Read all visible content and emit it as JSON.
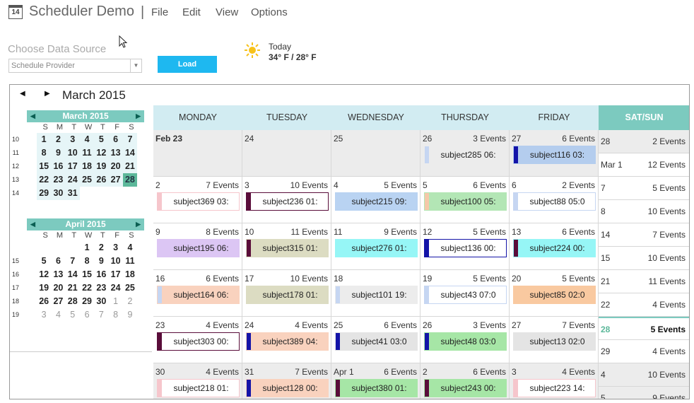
{
  "app": {
    "icon_text": "14",
    "title": "Scheduler Demo",
    "separator": "|"
  },
  "menu": [
    "File",
    "Edit",
    "View",
    "Options"
  ],
  "data_source": {
    "label": "Choose Data Source",
    "selected": "Schedule Provider",
    "load_label": "Load"
  },
  "weather": {
    "today": "Today",
    "temp": "34° F / 28° F",
    "icon": "sun-icon"
  },
  "scheduler": {
    "title": "March 2015",
    "prev": "◀",
    "next": "▶"
  },
  "mini_calendars": [
    {
      "title": "March 2015",
      "dow": [
        "S",
        "M",
        "T",
        "W",
        "T",
        "F",
        "S"
      ],
      "weeks": [
        {
          "wk": "10",
          "days": [
            "1",
            "2",
            "3",
            "4",
            "5",
            "6",
            "7"
          ]
        },
        {
          "wk": "11",
          "days": [
            "8",
            "9",
            "10",
            "11",
            "12",
            "13",
            "14"
          ]
        },
        {
          "wk": "12",
          "days": [
            "15",
            "16",
            "17",
            "18",
            "19",
            "20",
            "21"
          ]
        },
        {
          "wk": "13",
          "days": [
            "22",
            "23",
            "24",
            "25",
            "26",
            "27",
            "28"
          ]
        },
        {
          "wk": "14",
          "days": [
            "29",
            "30",
            "31",
            "",
            "",
            "",
            ""
          ]
        }
      ]
    },
    {
      "title": "April 2015",
      "dow": [
        "S",
        "M",
        "T",
        "W",
        "T",
        "F",
        "S"
      ],
      "weeks": [
        {
          "wk": "",
          "days": [
            "",
            "",
            "",
            "1",
            "2",
            "3",
            "4"
          ]
        },
        {
          "wk": "15",
          "days": [
            "5",
            "6",
            "7",
            "8",
            "9",
            "10",
            "11"
          ]
        },
        {
          "wk": "16",
          "days": [
            "12",
            "13",
            "14",
            "15",
            "16",
            "17",
            "18"
          ]
        },
        {
          "wk": "17",
          "days": [
            "19",
            "20",
            "21",
            "22",
            "23",
            "24",
            "25"
          ]
        },
        {
          "wk": "18",
          "days": [
            "26",
            "27",
            "28",
            "29",
            "30",
            "1",
            "2"
          ]
        },
        {
          "wk": "19",
          "days": [
            "3",
            "4",
            "5",
            "6",
            "7",
            "8",
            "9"
          ]
        }
      ]
    }
  ],
  "day_headers": [
    "MONDAY",
    "TUESDAY",
    "WEDNESDAY",
    "THURSDAY",
    "FRIDAY",
    "SAT/SUN"
  ],
  "weeks": [
    {
      "days": [
        {
          "date": "Feb 23",
          "count": "",
          "event": "",
          "color": "",
          "bar": ""
        },
        {
          "date": "24",
          "count": "",
          "event": "",
          "color": "",
          "bar": ""
        },
        {
          "date": "25",
          "count": "",
          "event": "",
          "color": "",
          "bar": ""
        },
        {
          "date": "26",
          "count": "3 Events",
          "event": "subject285 06:",
          "color": "#ececec",
          "bar": "#c6d6f2"
        },
        {
          "date": "27",
          "count": "6 Events",
          "event": "subject116 03:",
          "color": "#b4cdee",
          "bar": "#1414a8"
        }
      ],
      "weekend": [
        {
          "date": "28",
          "count": "2 Events"
        },
        {
          "date": "Mar 1",
          "count": "12 Events"
        }
      ]
    },
    {
      "days": [
        {
          "date": "2",
          "count": "7 Events",
          "event": "subject369 03:",
          "color": "#ffffff",
          "bar": "#f6c6cc"
        },
        {
          "date": "3",
          "count": "10 Events",
          "event": "subject236 01:",
          "color": "#ffffff",
          "bar": "#5a0d3a"
        },
        {
          "date": "4",
          "count": "5 Events",
          "event": "subject215 09:",
          "color": "#b9d3f2",
          "bar": "#b9d3f2"
        },
        {
          "date": "5",
          "count": "6 Events",
          "event": "subject100 05:",
          "color": "#b3e6b5",
          "bar": "#f4c8a8"
        },
        {
          "date": "6",
          "count": "2 Events",
          "event": "subject88 05:0",
          "color": "#ffffff",
          "bar": "#c6d6f2"
        }
      ],
      "weekend": [
        {
          "date": "7",
          "count": "5 Events"
        },
        {
          "date": "8",
          "count": "10 Events"
        }
      ]
    },
    {
      "days": [
        {
          "date": "9",
          "count": "8 Events",
          "event": "subject195 06:",
          "color": "#dcc6f4",
          "bar": "#dcc6f4"
        },
        {
          "date": "10",
          "count": "11 Events",
          "event": "subject315 01:",
          "color": "#dcdcc2",
          "bar": "#5a0d3a"
        },
        {
          "date": "11",
          "count": "9 Events",
          "event": "subject276 01:",
          "color": "#96f6f6",
          "bar": "#96f6f6"
        },
        {
          "date": "12",
          "count": "5 Events",
          "event": "subject136 00:",
          "color": "#ffffff",
          "bar": "#1414a8"
        },
        {
          "date": "13",
          "count": "6 Events",
          "event": "subject224 00:",
          "color": "#96f6f6",
          "bar": "#5a0d3a"
        }
      ],
      "weekend": [
        {
          "date": "14",
          "count": "7 Events"
        },
        {
          "date": "15",
          "count": "10 Events"
        }
      ]
    },
    {
      "days": [
        {
          "date": "16",
          "count": "6 Events",
          "event": "subject164 06:",
          "color": "#f9d2be",
          "bar": "#c6d6f2"
        },
        {
          "date": "17",
          "count": "10 Events",
          "event": "subject178 01:",
          "color": "#dcdcc2",
          "bar": "#dcdcc2"
        },
        {
          "date": "18",
          "count": "",
          "event": "subject101 19:",
          "color": "#ececec",
          "bar": "#c6d6f2"
        },
        {
          "date": "19",
          "count": "5 Events",
          "event": "subject43 07:0",
          "color": "#ffffff",
          "bar": "#c6d6f2"
        },
        {
          "date": "20",
          "count": "5 Events",
          "event": "subject85 02:0",
          "color": "#f9c9a0",
          "bar": "#f9c9a0"
        }
      ],
      "weekend": [
        {
          "date": "21",
          "count": "11 Events"
        },
        {
          "date": "22",
          "count": "4 Events"
        }
      ]
    },
    {
      "days": [
        {
          "date": "23",
          "count": "4 Events",
          "event": "subject303 00:",
          "color": "#ffffff",
          "bar": "#5a0d3a"
        },
        {
          "date": "24",
          "count": "4 Events",
          "event": "subject389 04:",
          "color": "#f9d2be",
          "bar": "#1414a8"
        },
        {
          "date": "25",
          "count": "6 Events",
          "event": "subject41 03:0",
          "color": "#e4e4e4",
          "bar": "#1414a8"
        },
        {
          "date": "26",
          "count": "3 Events",
          "event": "subject48 03:0",
          "color": "#a6e6a6",
          "bar": "#1414a8"
        },
        {
          "date": "27",
          "count": "7 Events",
          "event": "subject13 02:0",
          "color": "#e4e4e4",
          "bar": "#e4e4e4"
        }
      ],
      "weekend": [
        {
          "date": "28",
          "count": "5 Events",
          "today": true
        },
        {
          "date": "29",
          "count": "4 Events"
        }
      ]
    },
    {
      "days": [
        {
          "date": "30",
          "count": "4 Events",
          "event": "subject218 01:",
          "color": "#ffffff",
          "bar": "#f6c6cc"
        },
        {
          "date": "31",
          "count": "7 Events",
          "event": "subject128 00:",
          "color": "#f9d2be",
          "bar": "#1414a8"
        },
        {
          "date": "Apr 1",
          "count": "6 Events",
          "event": "subject380 01:",
          "color": "#a6e6a6",
          "bar": "#5a0d3a"
        },
        {
          "date": "2",
          "count": "6 Events",
          "event": "subject243 00:",
          "color": "#a6e6a6",
          "bar": "#5a0d3a"
        },
        {
          "date": "3",
          "count": "4 Events",
          "event": "subject223 14:",
          "color": "#ffffff",
          "bar": "#f6c6cc"
        }
      ],
      "weekend": [
        {
          "date": "4",
          "count": "10 Events"
        },
        {
          "date": "5",
          "count": "9 Events"
        }
      ]
    }
  ]
}
